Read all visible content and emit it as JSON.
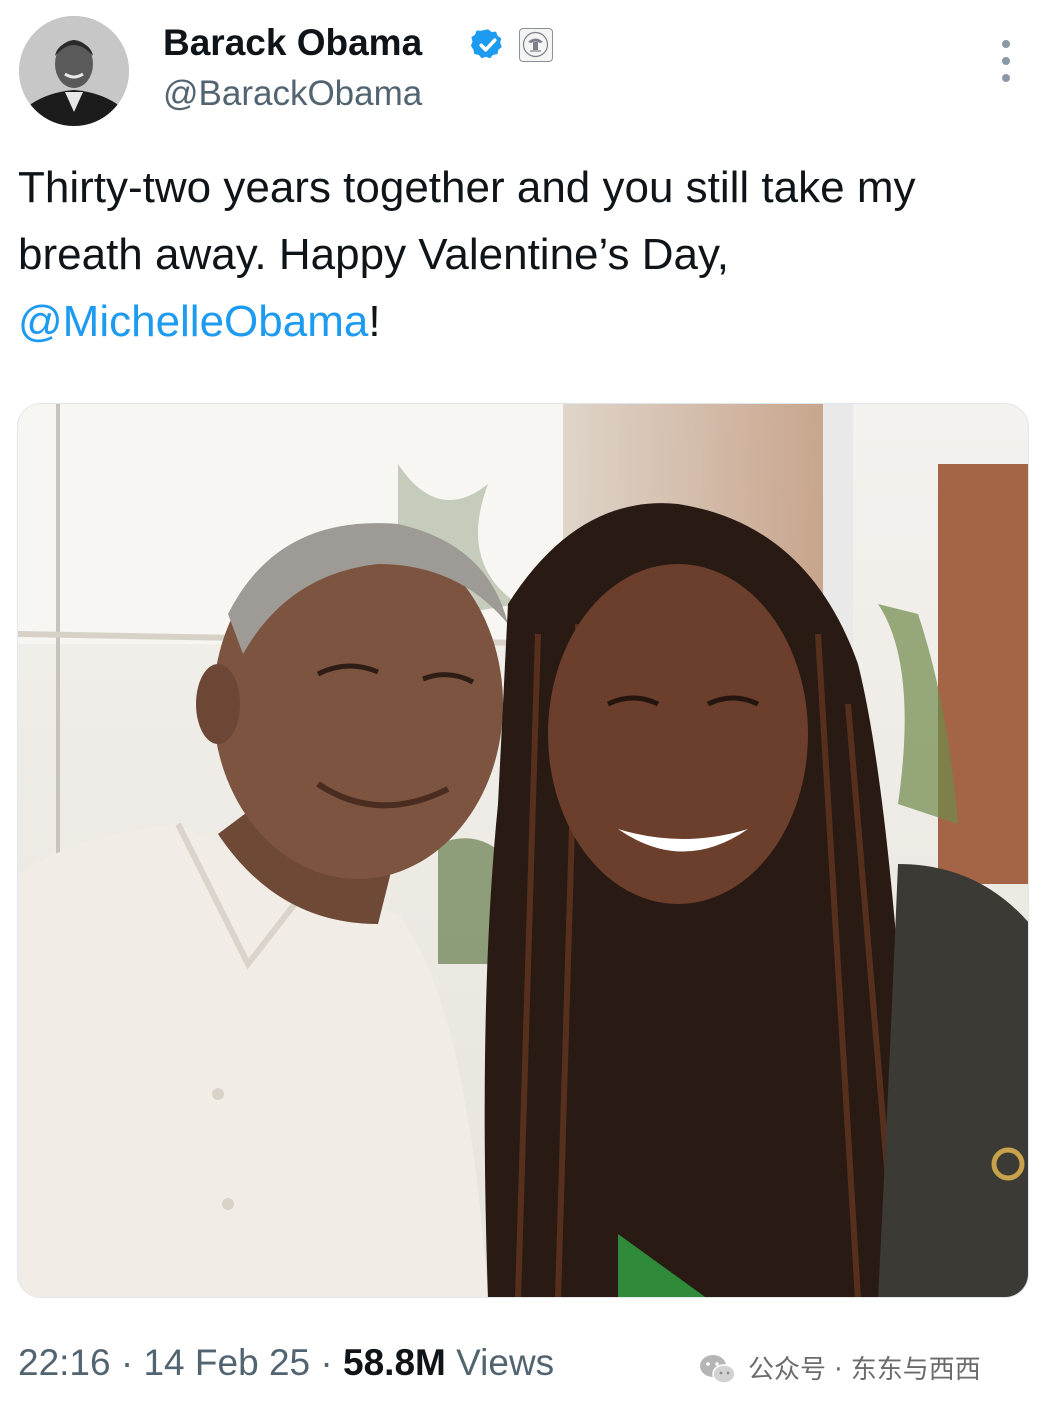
{
  "author": {
    "display_name": "Barack Obama",
    "handle": "@BarackObama",
    "verified_color": "#1d9bf0",
    "avatar_icon": "profile-photo",
    "affiliate_icon": "presidential-seal-icon"
  },
  "tweet": {
    "text_main": "Thirty-two years together and you still take my breath away. Happy Valentine’s Day, ",
    "mention": "@MichelleObama",
    "text_end": "!"
  },
  "meta": {
    "time": "22:16",
    "separator": " · ",
    "date": "14 Feb 25",
    "views_count": "58.8M",
    "views_label": " Views"
  },
  "watermark": {
    "text": "公众号 · 东东与西西",
    "icon": "wechat-icon"
  },
  "colors": {
    "text_primary": "#0f1419",
    "text_secondary": "#536471",
    "link": "#1d9bf0"
  }
}
